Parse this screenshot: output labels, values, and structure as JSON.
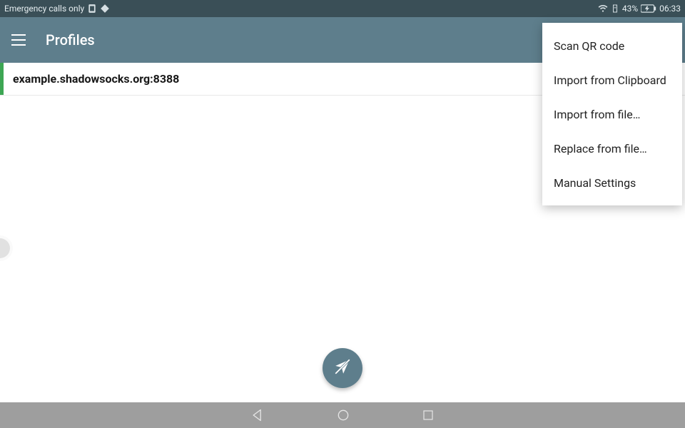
{
  "status": {
    "left_text": "Emergency calls only",
    "battery_text": "43%",
    "time": "06:33"
  },
  "appbar": {
    "title": "Profiles"
  },
  "profile": {
    "label": "example.shadowsocks.org:8388"
  },
  "menu": {
    "items": [
      {
        "label": "Scan QR code"
      },
      {
        "label": "Import from Clipboard"
      },
      {
        "label": "Import from file…"
      },
      {
        "label": "Replace from file…"
      },
      {
        "label": "Manual Settings"
      }
    ]
  }
}
